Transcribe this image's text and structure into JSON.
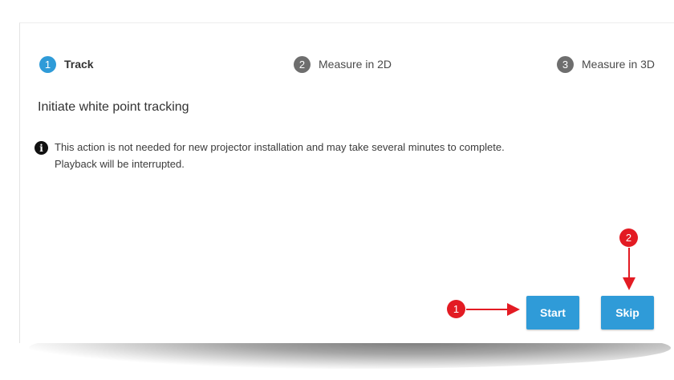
{
  "steps": [
    {
      "number": "1",
      "label": "Track",
      "state": "active"
    },
    {
      "number": "2",
      "label": "Measure in 2D",
      "state": "inactive"
    },
    {
      "number": "3",
      "label": "Measure in 3D",
      "state": "inactive"
    }
  ],
  "heading": "Initiate white point tracking",
  "info": {
    "icon": "info-icon",
    "glyph": "i",
    "line1": "This action is not needed for new projector installation and may take several minutes to complete.",
    "line2": "Playback will be interrupted."
  },
  "buttons": {
    "start_label": "Start",
    "skip_label": "Skip"
  },
  "callouts": {
    "start": "1",
    "skip": "2"
  },
  "colors": {
    "accent": "#2f9bd8",
    "inactive_step": "#6e6e6e",
    "callout": "#e31b23"
  }
}
